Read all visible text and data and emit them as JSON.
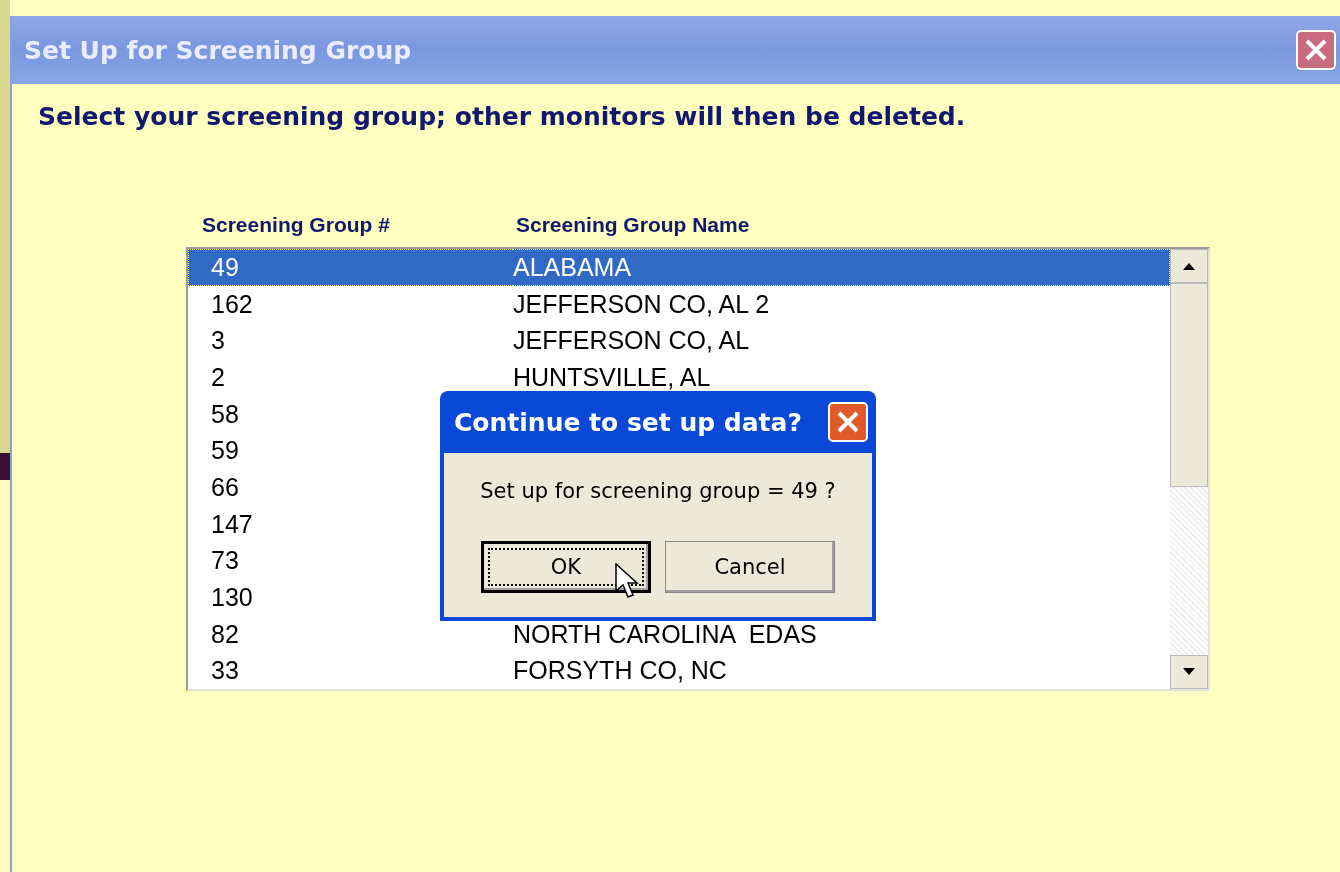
{
  "window": {
    "title": "Set Up for Screening Group"
  },
  "instruction": "Select your screening group; other monitors will then be deleted.",
  "list": {
    "columns": [
      "Screening Group #",
      "Screening Group Name"
    ],
    "rows": [
      {
        "number": "49",
        "name": "ALABAMA",
        "selected": true
      },
      {
        "number": "162",
        "name": "JEFFERSON CO, AL 2",
        "selected": false
      },
      {
        "number": "3",
        "name": "JEFFERSON CO, AL",
        "selected": false
      },
      {
        "number": "2",
        "name": "HUNTSVILLE, AL",
        "selected": false
      },
      {
        "number": "58",
        "selected": false
      },
      {
        "number": "59",
        "selected": false
      },
      {
        "number": "66",
        "selected": false
      },
      {
        "number": "147",
        "selected": false
      },
      {
        "number": "73",
        "selected": false
      },
      {
        "number": "130",
        "selected": false
      },
      {
        "number": "82",
        "name": "NORTH CAROLINA  EDAS",
        "selected": false
      },
      {
        "number": "33",
        "name": "FORSYTH CO, NC",
        "selected": false
      }
    ]
  },
  "dialog": {
    "title": "Continue to set up data?",
    "message": "Set up for screening group = 49 ?",
    "buttons": [
      {
        "label": "OK",
        "selected": true
      },
      {
        "label": "Cancel",
        "selected": false
      }
    ]
  }
}
